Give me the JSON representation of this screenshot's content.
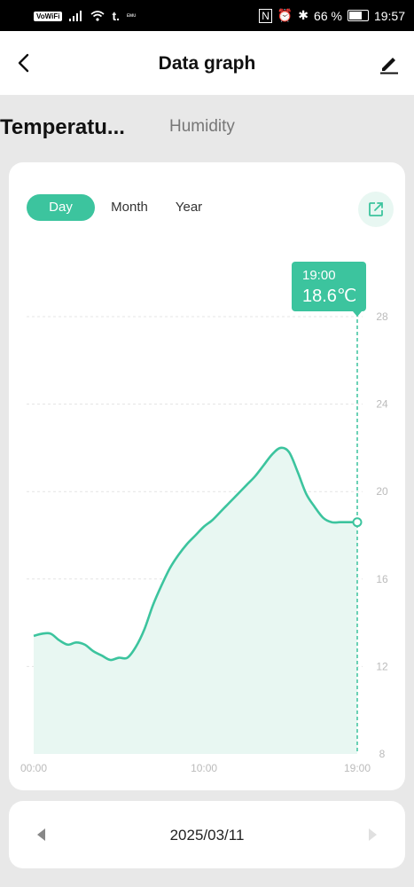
{
  "status_bar": {
    "wifi_badge": "VoWiFi",
    "carrier_1": "ᴇᴍᴜ",
    "battery_percent": "66 %",
    "time": "19:57"
  },
  "header": {
    "title": "Data graph",
    "back_icon": "chevron-left-icon",
    "edit_icon": "pencil-icon"
  },
  "tabs": {
    "active": "Temperatu...",
    "inactive": "Humidity"
  },
  "range_tabs": {
    "day": "Day",
    "month": "Month",
    "year": "Year",
    "selected": "Day"
  },
  "tooltip": {
    "time": "19:00",
    "value": "18.6℃"
  },
  "date_nav": {
    "date": "2025/03/11"
  },
  "colors": {
    "accent": "#3cc49e",
    "fill": "#e8f7f2",
    "grid": "#e4e4e4",
    "tick": "#bbbbbb"
  },
  "chart_data": {
    "type": "area",
    "x_ticks": [
      "00:00",
      "10:00",
      "19:00"
    ],
    "y_ticks": [
      8,
      12,
      16,
      20,
      24,
      28
    ],
    "ylim": [
      8,
      28
    ],
    "xlim": [
      0,
      19
    ],
    "y_axis_position": "right",
    "grid": true,
    "highlight_x": 19,
    "series": [
      {
        "x": [
          0,
          0.5,
          1,
          1.5,
          2,
          2.5,
          3,
          3.5,
          4,
          4.5,
          5,
          5.5,
          6,
          6.5,
          7,
          7.5,
          8,
          8.5,
          9,
          9.5,
          10,
          10.5,
          11,
          11.5,
          12,
          12.5,
          13,
          13.5,
          14,
          14.5,
          15,
          15.5,
          16,
          16.5,
          17,
          17.5,
          18,
          18.5,
          19
        ],
        "values": [
          13.4,
          13.5,
          13.5,
          13.2,
          13.0,
          13.1,
          13.0,
          12.7,
          12.5,
          12.3,
          12.4,
          12.4,
          12.9,
          13.7,
          14.8,
          15.7,
          16.5,
          17.1,
          17.6,
          18.0,
          18.4,
          18.7,
          19.1,
          19.5,
          19.9,
          20.3,
          20.7,
          21.2,
          21.7,
          22.0,
          21.8,
          20.9,
          19.9,
          19.3,
          18.8,
          18.6,
          18.6,
          18.6,
          18.6
        ]
      }
    ]
  }
}
